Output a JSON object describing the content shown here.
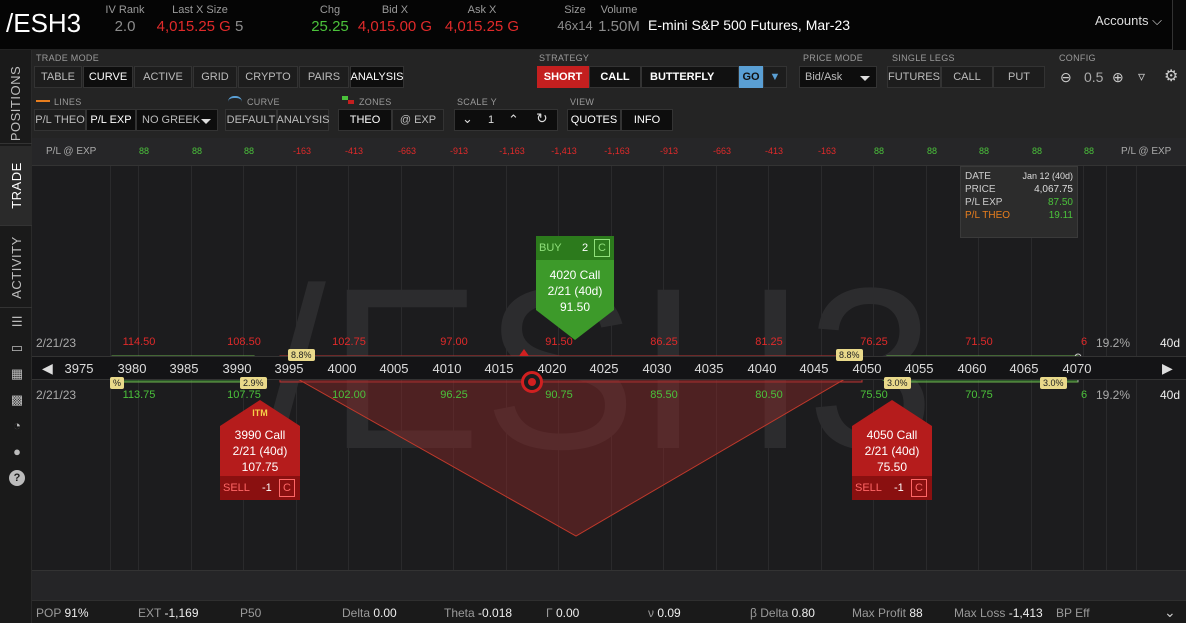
{
  "header": {
    "symbol": "/ESH3",
    "iv_rank_label": "IV Rank",
    "iv_rank": "2.0",
    "last_x_size_label": "Last X Size",
    "last": "4,015.25 G",
    "last_size": "5",
    "chg_label": "Chg",
    "chg": "25.25",
    "bid_x_label": "Bid X",
    "bid": "4,015.00 G",
    "ask_x_label": "Ask X",
    "ask": "4,015.25 G",
    "size_label": "Size",
    "size": "46x14",
    "volume_label": "Volume",
    "volume": "1.50M",
    "description": "E-mini S&P 500 Futures, Mar-23",
    "accounts": "Accounts"
  },
  "sidebar": {
    "positions": "POSITIONS",
    "trade": "TRADE",
    "activity": "ACTIVITY"
  },
  "toolbar": {
    "trade_mode_label": "TRADE MODE",
    "modes": [
      "TABLE",
      "CURVE",
      "ACTIVE",
      "GRID",
      "CRYPTO",
      "PAIRS"
    ],
    "analysis": "ANALYSIS",
    "strategy_label": "STRATEGY",
    "short": "SHORT",
    "call": "CALL",
    "butterfly": "BUTTERFLY",
    "go": "GO",
    "price_mode_label": "PRICE MODE",
    "price_mode": "Bid/Ask",
    "single_legs_label": "SINGLE LEGS",
    "futures": "FUTURES",
    "sl_call": "CALL",
    "sl_put": "PUT",
    "config_label": "CONFIG",
    "zoom": "0.5",
    "lines_label": "LINES",
    "pl_theo": "P/L THEO",
    "pl_exp": "P/L EXP",
    "greek": "NO GREEK",
    "curve_label": "CURVE",
    "default": "DEFAULT",
    "curve_analysis": "ANALYSIS",
    "zones_label": "ZONES",
    "theo": "THEO",
    "at_exp": "@ EXP",
    "scale_y_label": "SCALE Y",
    "scale_y": "1",
    "view_label": "VIEW",
    "quotes": "QUOTES",
    "info": "INFO"
  },
  "chart_data": {
    "type": "line",
    "pl_label": "P/L @ EXP",
    "pl_values": [
      "88",
      "88",
      "88",
      "-163",
      "-413",
      "-663",
      "-913",
      "-1,163",
      "-1,413",
      "-1,163",
      "-913",
      "-663",
      "-413",
      "-163",
      "88",
      "88",
      "88",
      "88",
      "88"
    ],
    "strikes": [
      "3975",
      "3980",
      "3985",
      "3990",
      "3995",
      "4000",
      "4005",
      "4010",
      "4015",
      "4020",
      "4025",
      "4030",
      "4035",
      "4040",
      "4045",
      "4050",
      "4055",
      "4060",
      "4065",
      "4070"
    ],
    "expiry": "2/21/23",
    "iv": "19.2%",
    "dte": "40d",
    "calls_top": [
      "114.50",
      "108.50",
      "102.75",
      "97.00",
      "91.50",
      "86.25",
      "81.25",
      "76.25",
      "71.50",
      "6"
    ],
    "calls_bottom": [
      "113.75",
      "107.75",
      "102.00",
      "96.25",
      "90.75",
      "85.50",
      "80.50",
      "75.50",
      "70.75",
      "6"
    ],
    "pct_left_top": "8.8%",
    "pct_left_bottom": "2.9%",
    "pct_edge": "%",
    "pct_right_top": "8.8%",
    "pct_right_bottom1": "3.0%",
    "pct_right_bottom2": "3.0%",
    "watermark": "/ESH3"
  },
  "info": {
    "date_label": "DATE",
    "date": "Jan 12 (40d)",
    "price_label": "PRICE",
    "price": "4,067.75",
    "plexp_label": "P/L EXP",
    "plexp": "87.50",
    "pltheo_label": "P/L THEO",
    "pltheo": "19.11"
  },
  "legs": {
    "buy": {
      "side": "BUY",
      "qty": "2",
      "type": "C",
      "title": "4020 Call",
      "exp": "2/21 (40d)",
      "price": "91.50"
    },
    "sell1": {
      "side": "SELL",
      "qty": "-1",
      "type": "C",
      "badge": "ITM",
      "title": "3990 Call",
      "exp": "2/21 (40d)",
      "price": "107.75"
    },
    "sell2": {
      "side": "SELL",
      "qty": "-1",
      "type": "C",
      "title": "4050 Call",
      "exp": "2/21 (40d)",
      "price": "75.50"
    }
  },
  "bottom": {
    "pop_label": "POP",
    "pop": "91%",
    "ext_label": "EXT",
    "ext": "-1,169",
    "p50_label": "P50",
    "delta_label": "Delta",
    "delta": "0.00",
    "theta_label": "Theta",
    "theta": "-0.018",
    "gamma_label": "Γ",
    "gamma": "0.00",
    "vega_label": "ν",
    "vega": "0.09",
    "bdelta_label": "β Delta",
    "bdelta": "0.80",
    "maxp_label": "Max Profit",
    "maxp": "88",
    "maxl_label": "Max Loss",
    "maxl": "-1,413",
    "bpeff_label": "BP Eff"
  },
  "colors": {
    "accent": "#e02a2a",
    "profit": "#4bc23b",
    "buy": "#3d9a2a",
    "sell": "#b51c1c",
    "go": "#5a9fd4"
  }
}
